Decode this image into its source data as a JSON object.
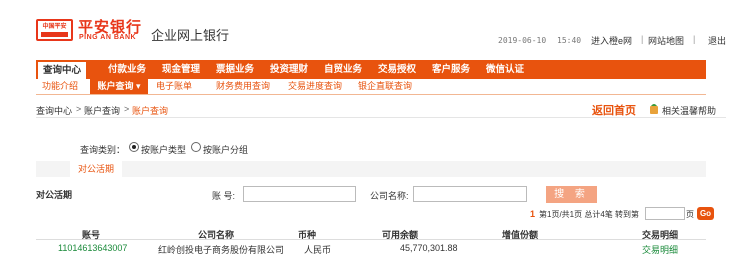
{
  "header": {
    "badge_text": "中国平安",
    "bank_name_cn": "平安银行",
    "bank_name_en": "PING AN BANK",
    "portal_title": "企业网上银行",
    "date": "2019-06-10",
    "time": "15:40",
    "links": [
      "进入橙e网",
      "网站地图",
      "退出"
    ]
  },
  "nav": {
    "items": [
      "查询中心",
      "付款业务",
      "现金管理",
      "票据业务",
      "投资理财",
      "自贸业务",
      "交易授权",
      "客户服务",
      "微信认证"
    ],
    "active_index": 0
  },
  "subnav": {
    "items": [
      "功能介绍",
      "账户查询",
      "电子账单",
      "财务费用查询",
      "交易进度查询",
      "银企直联查询"
    ],
    "active_index": 1
  },
  "breadcrumb": [
    "查询中心",
    "账户查询",
    "账户查询"
  ],
  "toolbar": {
    "back_home": "返回首页",
    "help": "相关温馨帮助"
  },
  "query": {
    "label": "查询类别：",
    "options": [
      "按账户类型",
      "按账户分组"
    ],
    "selected_index": 0
  },
  "tabs": [
    "对公活期"
  ],
  "search": {
    "section_title": "对公活期",
    "account_label": "账  号:",
    "account_value": "",
    "company_label": "公司名称:",
    "company_value": "",
    "button_label": "搜 索"
  },
  "pager": {
    "current": "1",
    "summary": "第1页/共1页 总计4笔 转到第",
    "page_label": "页",
    "go_label": "Go",
    "input_value": ""
  },
  "table": {
    "columns": [
      "账号",
      "公司名称",
      "币种",
      "可用余额",
      "增值份额",
      "交易明细"
    ],
    "rows": [
      [
        "11014613643007",
        "红岭创投电子商务股份有限公司",
        "人民币",
        "45,770,301.88",
        "",
        "交易明细"
      ]
    ]
  },
  "colors": {
    "brand": "#e8361a",
    "nav": "#e8530e",
    "link_green": "#1a8a3a"
  }
}
